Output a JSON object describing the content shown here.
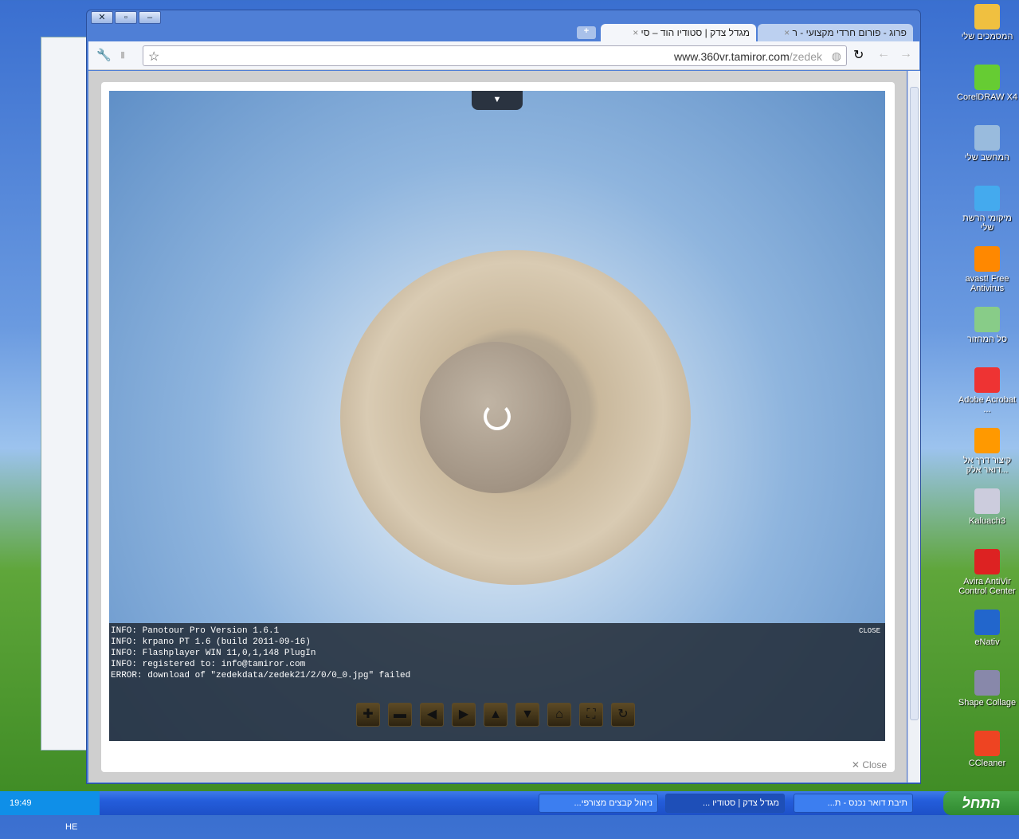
{
  "desktop_icons": [
    "המסמכים שלי",
    "CorelDRAW X4",
    "המחשב שלי",
    "מיקומי הרשת שלי",
    "avast! Free Antivirus",
    "סל המחזור",
    "Adobe Acrobat ...",
    "קיצור דרך אל דואר אלק...",
    "Kaluach3",
    "Avira AntiVir Control Center",
    "eNativ",
    "Shape Collage",
    "CCleaner"
  ],
  "browser": {
    "tabs": [
      {
        "title": "מגדל צדק | סטודיו הוד – סי",
        "active": true
      },
      {
        "title": "פרוג - פורום חרדי מקצועי - ר",
        "active": false
      }
    ],
    "new_tab": "+",
    "url_host": "www.360vr.tamiror.com",
    "url_path": "/zedek"
  },
  "viewer": {
    "toggle": "▼",
    "log_close": "CLOSE",
    "log": [
      "INFO: Panotour Pro Version 1.6.1",
      "INFO: krpano PT 1.6 (build 2011-09-16)",
      "INFO: Flashplayer WIN 11,0,1,148 PlugIn",
      "INFO: registered to: info@tamiror.com",
      "ERROR: download of \"zedekdata/zedek21/2/0/0_0.jpg\" failed"
    ],
    "controls": [
      "zoom-in",
      "zoom-out",
      "left",
      "right",
      "up",
      "down",
      "home",
      "fullscreen",
      "autorotate"
    ],
    "close_label": "Close"
  },
  "taskbar": {
    "start": "התחל",
    "buttons": [
      "תיבת דואר נכנס - ת...",
      "מגדל צדק | סטודיו ...",
      "ניהול קבצים מצורפי..."
    ],
    "lang": "HE",
    "clock": "19:49"
  }
}
